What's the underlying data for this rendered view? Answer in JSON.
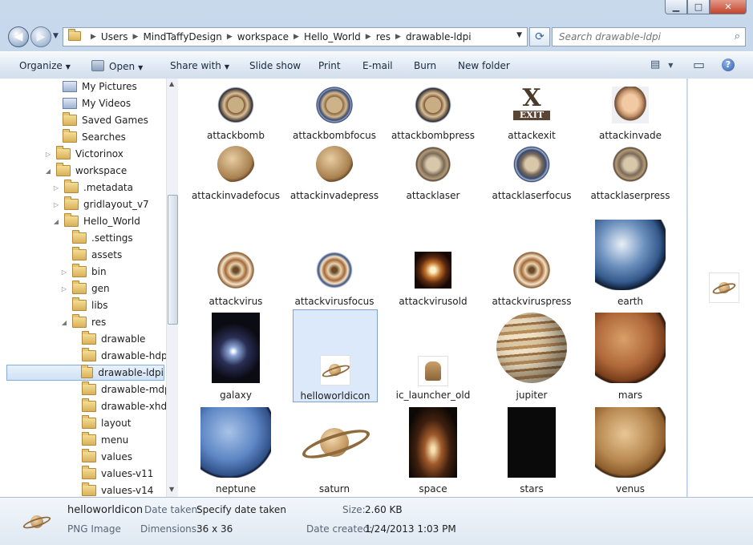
{
  "window": {
    "buttons": {
      "minimize_glyph": "▁",
      "maximize_glyph": "□",
      "close_glyph": "✕"
    }
  },
  "nav": {
    "back_glyph": "◀",
    "forward_glyph": "▶",
    "dropdown_glyph": "▼"
  },
  "address": {
    "crumbs": [
      "Users",
      "MindTaffyDesign",
      "workspace",
      "Hello_World",
      "res",
      "drawable-ldpi"
    ],
    "separator": "▶",
    "dropdown_glyph": "▼",
    "refresh_glyph": "⟳"
  },
  "search": {
    "placeholder": "Search drawable-ldpi",
    "icon": "search-icon",
    "icon_glyph": "⌕"
  },
  "toolbar": {
    "organize": "Organize",
    "open": "Open",
    "share_with": "Share with",
    "slide_show": "Slide show",
    "print": "Print",
    "email": "E-mail",
    "burn": "Burn",
    "new_folder": "New folder",
    "dropdown_glyph": "▼",
    "views_glyph": "▤",
    "preview_glyph": "▭",
    "help_glyph": "?"
  },
  "tree": {
    "items": [
      {
        "label": "My Pictures"
      },
      {
        "label": "My Videos"
      },
      {
        "label": "Saved Games"
      },
      {
        "label": "Searches"
      },
      {
        "label": "Victorinox"
      },
      {
        "label": "workspace"
      },
      {
        "label": ".metadata"
      },
      {
        "label": "gridlayout_v7"
      },
      {
        "label": "Hello_World"
      },
      {
        "label": ".settings"
      },
      {
        "label": "assets"
      },
      {
        "label": "bin"
      },
      {
        "label": "gen"
      },
      {
        "label": "libs"
      },
      {
        "label": "res"
      },
      {
        "label": "drawable"
      },
      {
        "label": "drawable-hdpi"
      },
      {
        "label": "drawable-ldpi"
      },
      {
        "label": "drawable-mdpi"
      },
      {
        "label": "drawable-xhdpi"
      },
      {
        "label": "layout"
      },
      {
        "label": "menu"
      },
      {
        "label": "values"
      },
      {
        "label": "values-v11"
      },
      {
        "label": "values-v14"
      }
    ],
    "collapsed_glyph": "▷",
    "expanded_glyph": "◢"
  },
  "files": [
    {
      "name": "attackbomb"
    },
    {
      "name": "attackbombfocus"
    },
    {
      "name": "attackbombpress"
    },
    {
      "name": "attackexit"
    },
    {
      "name": "attackinvade"
    },
    {
      "name": "attackinvadefocus"
    },
    {
      "name": "attackinvadepress"
    },
    {
      "name": "attacklaser"
    },
    {
      "name": "attacklaserfocus"
    },
    {
      "name": "attacklaserpress"
    },
    {
      "name": "attackvirus"
    },
    {
      "name": "attackvirusfocus"
    },
    {
      "name": "attackvirusold"
    },
    {
      "name": "attackviruspress"
    },
    {
      "name": "earth"
    },
    {
      "name": "galaxy"
    },
    {
      "name": "helloworldicon"
    },
    {
      "name": "ic_launcher_old"
    },
    {
      "name": "jupiter"
    },
    {
      "name": "mars"
    },
    {
      "name": "neptune"
    },
    {
      "name": "saturn"
    },
    {
      "name": "space"
    },
    {
      "name": "stars"
    },
    {
      "name": "venus"
    }
  ],
  "exit_icon": {
    "letter": "X",
    "word": "EXIT"
  },
  "details": {
    "name": "helloworldicon",
    "type": "PNG Image",
    "date_taken_label": "Date taken:",
    "date_taken_value": "Specify date taken",
    "dimensions_label": "Dimensions:",
    "dimensions_value": "36 x 36",
    "size_label": "Size:",
    "size_value": "2.60 KB",
    "date_created_label": "Date created:",
    "date_created_value": "1/24/2013 1:03 PM"
  },
  "scroll": {
    "up_glyph": "▲",
    "down_glyph": "▼"
  }
}
